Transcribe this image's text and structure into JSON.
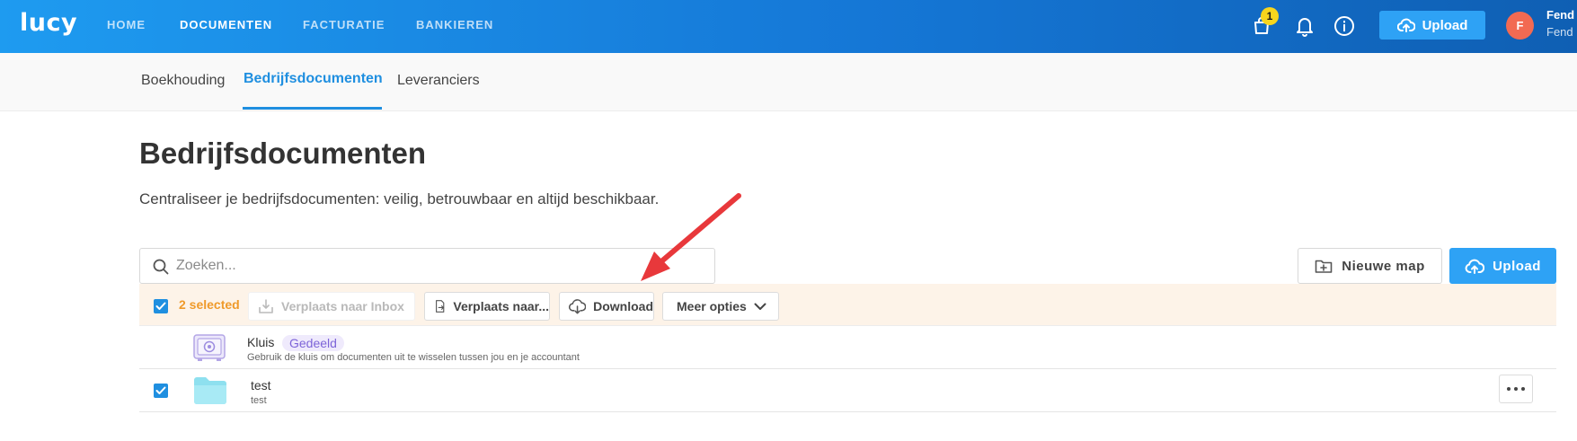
{
  "app": {
    "logo": "lucy"
  },
  "nav": {
    "items": [
      {
        "label": "HOME",
        "active": false
      },
      {
        "label": "DOCUMENTEN",
        "active": true
      },
      {
        "label": "FACTURATIE",
        "active": false
      },
      {
        "label": "BANKIEREN",
        "active": false
      }
    ],
    "notification_count": "1",
    "upload_label": "Upload",
    "avatar_initial": "F",
    "user_name": "Fend",
    "user_sub": "Fend"
  },
  "subnav": {
    "tabs": [
      {
        "label": "Boekhouding",
        "active": false
      },
      {
        "label": "Bedrijfsdocumenten",
        "active": true
      },
      {
        "label": "Leveranciers",
        "active": false
      }
    ]
  },
  "page": {
    "title": "Bedrijfsdocumenten",
    "description": "Centraliseer je bedrijfsdocumenten: veilig, betrouwbaar en altijd beschikbaar."
  },
  "search": {
    "placeholder": "Zoeken..."
  },
  "actions": {
    "new_folder_label": "Nieuwe map",
    "upload_label": "Upload"
  },
  "selection": {
    "count_label": "2 selected",
    "buttons": {
      "move_inbox": "Verplaats naar Inbox",
      "move_to": "Verplaats naar...",
      "download": "Download",
      "more": "Meer opties"
    }
  },
  "rows": [
    {
      "name": "Kluis",
      "tag": "Gedeeld",
      "sub": "Gebruik de kluis om documenten uit te wisselen tussen jou en je accountant",
      "selected": false
    },
    {
      "name": "test",
      "sub": "test",
      "selected": true
    }
  ],
  "colors": {
    "accent": "#1f8fe0",
    "selection_bg": "#fdf3e8",
    "selection_text": "#ef9a2a",
    "annotation_arrow": "#e8383b"
  }
}
